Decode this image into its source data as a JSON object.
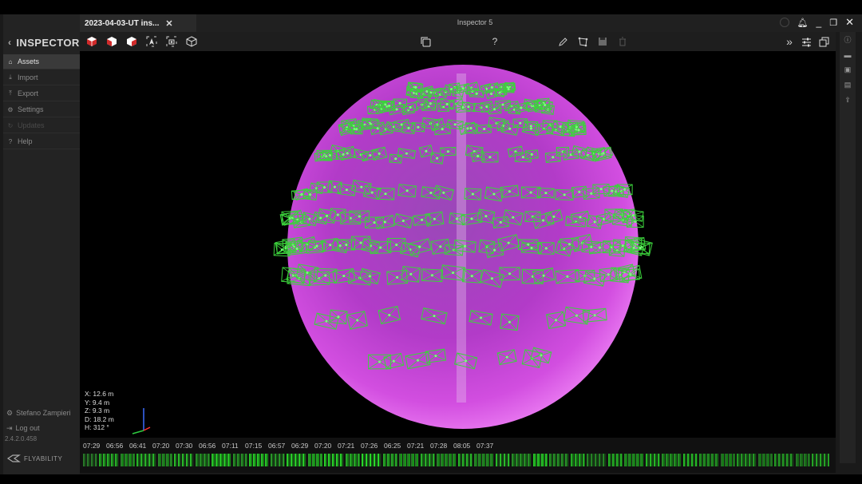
{
  "app": {
    "title": "Inspector 5",
    "tab_title": "2023-04-03-UT ins...",
    "brand": "INSPECTOR"
  },
  "sidebar": {
    "items": [
      {
        "label": "Assets",
        "icon": "home-icon",
        "state": "active"
      },
      {
        "label": "Import",
        "icon": "download-icon",
        "state": "normal"
      },
      {
        "label": "Export",
        "icon": "upload-icon",
        "state": "normal"
      },
      {
        "label": "Settings",
        "icon": "gear-icon",
        "state": "normal"
      },
      {
        "label": "Updates",
        "icon": "refresh-icon",
        "state": "disabled"
      },
      {
        "label": "Help",
        "icon": "help-icon",
        "state": "normal"
      }
    ],
    "user": "Stefano Zampieri",
    "logout": "Log out",
    "version": "2.4.2.0.458",
    "company": "FLYABILITY"
  },
  "toolbar": {
    "left_icons": [
      "cube-red-icon",
      "cube-red-front-icon",
      "cube-red-side-icon",
      "navigate-icon",
      "camera-target-icon",
      "cube-outline-icon"
    ],
    "center_icons": [
      "copy-icon",
      "help-icon"
    ],
    "right_icons": [
      "pencil-icon",
      "polygon-icon",
      "save-icon",
      "trash-icon"
    ],
    "far_right_icons": [
      "chevrons-right-icon",
      "sliders-icon",
      "window-restore-icon"
    ]
  },
  "rail_icons": [
    "info-icon",
    "folder-icon",
    "image-icon",
    "document-icon",
    "share-icon"
  ],
  "viewport": {
    "coords": {
      "x": "X:  12.6 m",
      "y": "Y:   9.4 m",
      "z": "Z:   9.3 m",
      "d": "D: 18.2 m",
      "h": "H:    312 °"
    },
    "sphere_color": "#b83cc8",
    "frustum_color": "#3cd23c"
  },
  "timeline": {
    "times": [
      "07:29",
      "06:56",
      "06:41",
      "07:20",
      "07:30",
      "06:56",
      "07:11",
      "07:15",
      "06:57",
      "06:29",
      "07:20",
      "07:21",
      "07:26",
      "06:25",
      "07:21",
      "07:28",
      "08:05",
      "07:37"
    ]
  }
}
